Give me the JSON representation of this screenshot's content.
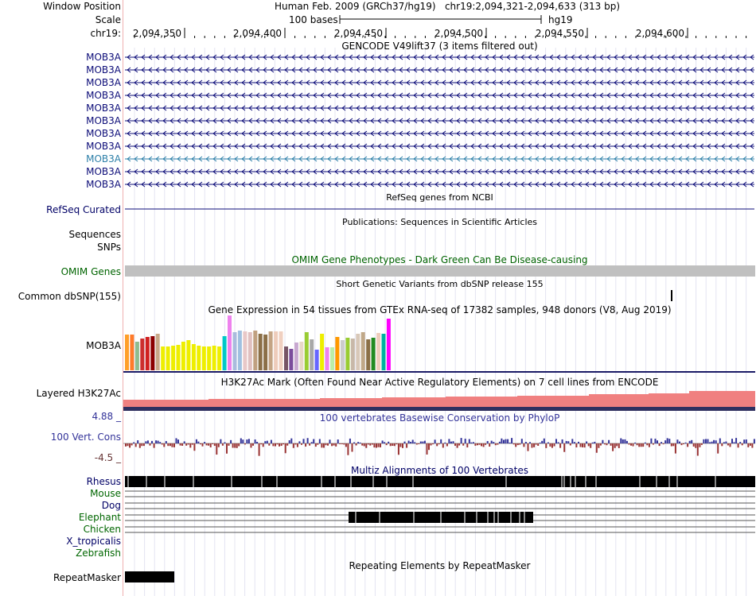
{
  "header": {
    "window_position_label": "Window Position",
    "scale_label": "Scale",
    "chrom_label": "chr19:",
    "assembly_position": "Human Feb. 2009 (GRCh37/hg19)   chr19:2,094,321-2,094,633 (313 bp)",
    "scale_text": "100 bases",
    "db": "hg19",
    "ruler_ticks": [
      "2,094,350",
      "2,094,400",
      "2,094,450",
      "2,094,500",
      "2,094,550",
      "2,094,600"
    ]
  },
  "gencode": {
    "title": "GENCODE V49lift37 (3 items filtered out)",
    "transcripts": [
      "MOB3A",
      "MOB3A",
      "MOB3A",
      "MOB3A",
      "MOB3A",
      "MOB3A",
      "MOB3A",
      "MOB3A",
      "MOB3A",
      "MOB3A",
      "MOB3A"
    ],
    "highlighted_index": 8,
    "colors": {
      "normal": "#0c0c78",
      "highlight": "#2c7fa8"
    }
  },
  "refseq": {
    "title": "RefSeq genes from NCBI",
    "label": "RefSeq Curated"
  },
  "publications": {
    "title": "Publications: Sequences in Scientific Articles",
    "labels": [
      "Sequences",
      "SNPs"
    ]
  },
  "omim": {
    "title": "OMIM Gene Phenotypes - Dark Green Can Be Disease-causing",
    "label": "OMIM Genes",
    "bar_color": "#c0c0c0"
  },
  "dbsnp": {
    "title": "Short Genetic Variants from dbSNP release 155",
    "label": "Common dbSNP(155)"
  },
  "gtex": {
    "title": "Gene Expression in 54 tissues from GTEx RNA-seq of 17382 samples, 948 donors (V8, Aug 2019)",
    "label": "MOB3A",
    "bars": [
      {
        "color": "#ff9f2a",
        "value": 45
      },
      {
        "color": "#ff7b2a",
        "value": 45
      },
      {
        "color": "#8fbc8f",
        "value": 36
      },
      {
        "color": "#cc2e2e",
        "value": 40
      },
      {
        "color": "#d02020",
        "value": 42
      },
      {
        "color": "#8b0000",
        "value": 43
      },
      {
        "color": "#c8a888",
        "value": 46
      },
      {
        "color": "#eeee00",
        "value": 30
      },
      {
        "color": "#eeee00",
        "value": 30
      },
      {
        "color": "#eeee00",
        "value": 31
      },
      {
        "color": "#eeee00",
        "value": 32
      },
      {
        "color": "#eeee00",
        "value": 36
      },
      {
        "color": "#eeee00",
        "value": 38
      },
      {
        "color": "#eeee00",
        "value": 33
      },
      {
        "color": "#eeee00",
        "value": 31
      },
      {
        "color": "#eeee00",
        "value": 30
      },
      {
        "color": "#eeee00",
        "value": 30
      },
      {
        "color": "#eeee00",
        "value": 31
      },
      {
        "color": "#eeee00",
        "value": 30
      },
      {
        "color": "#00c8c8",
        "value": 43
      },
      {
        "color": "#ee82ee",
        "value": 69
      },
      {
        "color": "#aabbdd",
        "value": 48
      },
      {
        "color": "#a0c0e0",
        "value": 50
      },
      {
        "color": "#e8c8c8",
        "value": 49
      },
      {
        "color": "#e0c0c0",
        "value": 48
      },
      {
        "color": "#c0a080",
        "value": 50
      },
      {
        "color": "#8b6f47",
        "value": 46
      },
      {
        "color": "#8b6f47",
        "value": 45
      },
      {
        "color": "#c4a484",
        "value": 49
      },
      {
        "color": "#eeccbb",
        "value": 49
      },
      {
        "color": "#f0d0c0",
        "value": 49
      },
      {
        "color": "#775566",
        "value": 30
      },
      {
        "color": "#7b4c9c",
        "value": 27
      },
      {
        "color": "#c8a8d0",
        "value": 35
      },
      {
        "color": "#e8d8c8",
        "value": 36
      },
      {
        "color": "#99cc33",
        "value": 48
      },
      {
        "color": "#a8a8a8",
        "value": 39
      },
      {
        "color": "#6666ff",
        "value": 26
      },
      {
        "color": "#eeee00",
        "value": 46
      },
      {
        "color": "#ee82ee",
        "value": 29
      },
      {
        "color": "#bbeeaa",
        "value": 29
      },
      {
        "color": "#ff9900",
        "value": 42
      },
      {
        "color": "#cccccc",
        "value": 38
      },
      {
        "color": "#99cc33",
        "value": 41
      },
      {
        "color": "#c8b8a8",
        "value": 40
      },
      {
        "color": "#d8c8b8",
        "value": 46
      },
      {
        "color": "#c0a888",
        "value": 48
      },
      {
        "color": "#8b6f47",
        "value": 39
      },
      {
        "color": "#228b22",
        "value": 41
      },
      {
        "color": "#eeccbb",
        "value": 47
      },
      {
        "color": "#00b0a0",
        "value": 46
      },
      {
        "color": "#ff00ff",
        "value": 65
      }
    ]
  },
  "h3k27ac": {
    "title": "H3K27Ac Mark (Often Found Near Active Regulatory Elements) on 7 cell lines from ENCODE",
    "label": "Layered H3K27Ac",
    "color": "#f08080",
    "dark_color": "#303060"
  },
  "phylop": {
    "title": "100 vertebrates Basewise Conservation by PhyloP",
    "label": "100 Vert. Cons",
    "max_label": "4.88 _",
    "min_label": "-4.5 _",
    "pos_color": "#333399",
    "neg_color": "#993333"
  },
  "multiz": {
    "title": "Multiz Alignments of 100 Vertebrates",
    "species": [
      "Rhesus",
      "Mouse",
      "Dog",
      "Elephant",
      "Chicken",
      "X_tropicalis",
      "Zebrafish"
    ]
  },
  "repeatmasker": {
    "title": "Repeating Elements by RepeatMasker",
    "label": "RepeatMasker"
  }
}
